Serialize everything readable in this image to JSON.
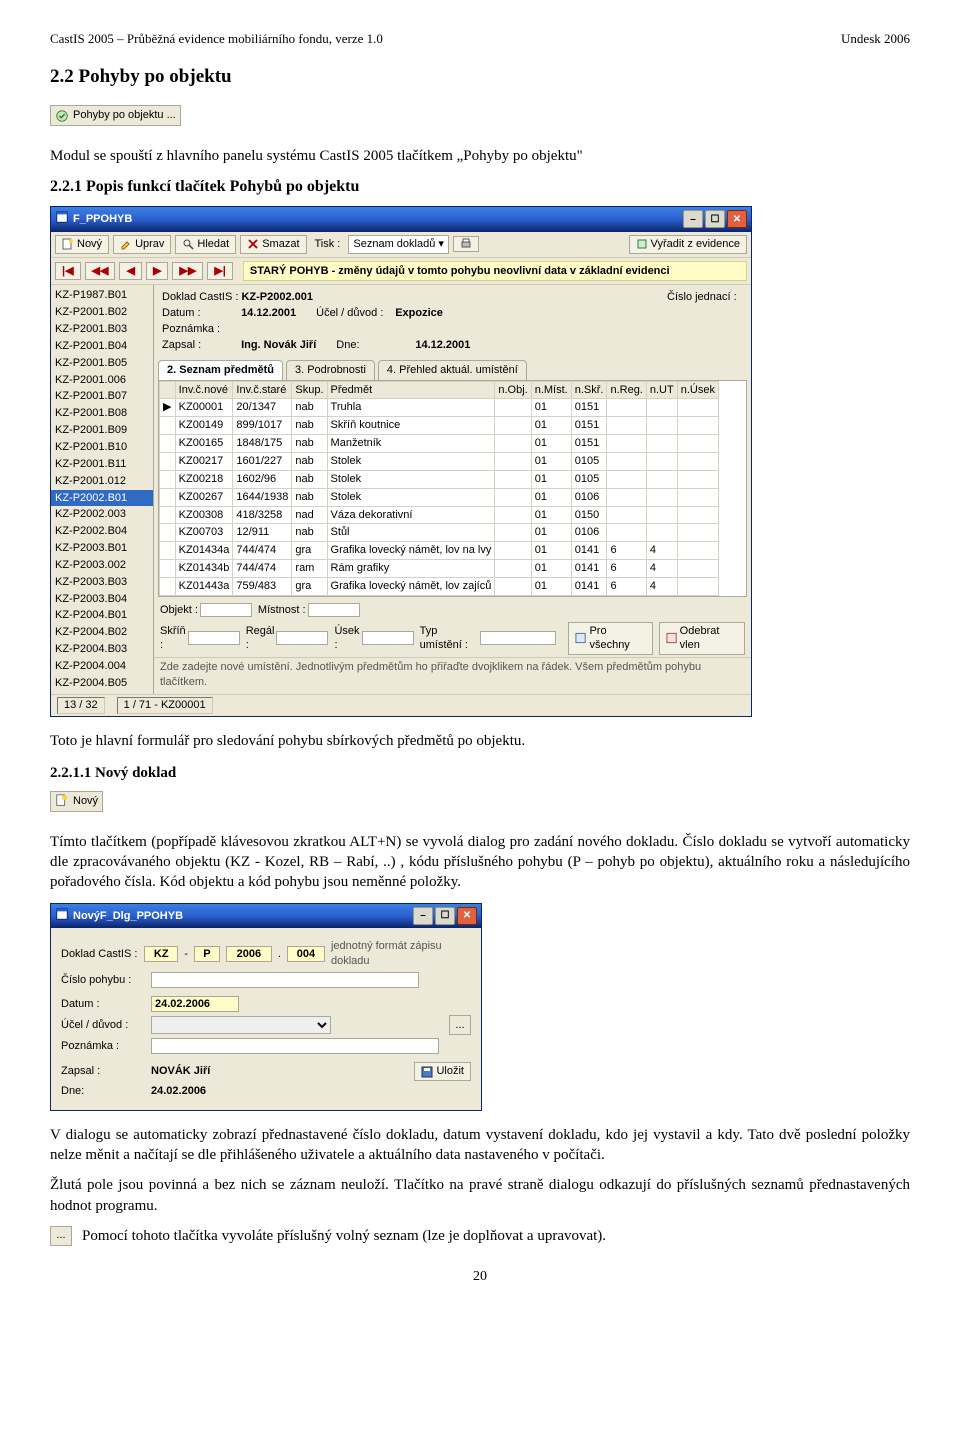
{
  "header": {
    "left": "CastIS 2005 – Průběžná evidence mobiliárního fondu, verze 1.0",
    "right": "Undesk 2006"
  },
  "section": {
    "number": "2.2",
    "title": "Pohyby po objektu"
  },
  "launcher_strip_label": "Pohyby po objektu ...",
  "body": {
    "p1": "Modul se spouští z hlavního panelu systému CastIS 2005 tlačítkem „Pohyby po objektu\"",
    "sub1_no": "2.2.1",
    "sub1_title": "Popis funkcí tlačítek Pohybů po objektu",
    "p2": "Toto je hlavní formulář pro sledování pohybu sbírkových předmětů po objektu.",
    "ss1_no": "2.2.1.1",
    "ss1_title": "Nový doklad",
    "new_btn": "Nový",
    "p3": "Tímto tlačítkem (popřípadě klávesovou zkratkou ALT+N) se vyvolá dialog pro zadání nového dokladu. Číslo dokladu se vytvoří automaticky dle zpracovávaného objektu (KZ - Kozel, RB – Rabí, ..) , kódu příslušného pohybu (P – pohyb po objektu), aktuálního roku a následujícího pořadového čísla. Kód objektu a kód pohybu jsou neměnné položky.",
    "p4": "V dialogu se automaticky zobrazí přednastavené číslo dokladu, datum vystavení dokladu, kdo jej vystavil a kdy. Tato dvě poslední položky nelze měnit a načítají se dle přihlášeného uživatele a aktuálního data nastaveného v počítači.",
    "p5": "Žlutá pole jsou povinná a bez nich se záznam neuloží. Tlačítko na pravé straně dialogu odkazují do příslušných seznamů přednastavených hodnot programu.",
    "p6": "Pomocí tohoto tlačítka vyvoláte příslušný volný seznam (lze je doplňovat a upravovat).",
    "page_number": "20"
  },
  "main_window": {
    "title": "F_PPOHYB",
    "toolbar": {
      "novy": "Nový",
      "uprav": "Uprav",
      "hledat": "Hledat",
      "smazat": "Smazat",
      "tisk_label": "Tisk :",
      "tisk_value": "Seznam dokladů",
      "vyradit": "Vyřadit z evidence"
    },
    "arrow_hint": "nav-arrows",
    "banner": "STARÝ POHYB - změny údajů v tomto pohybu neovlivní data v základní evidenci",
    "form": {
      "doklad_lab": "Doklad CastIS :",
      "doklad_val": "KZ-P2002.001",
      "cislojed_lab": "Číslo jednací :",
      "datum_lab": "Datum :",
      "datum_val": "14.12.2001",
      "ucel_lab": "Účel / důvod :",
      "ucel_val": "Expozice",
      "poznamka_lab": "Poznámka :",
      "zapsal_lab": "Zapsal :",
      "zapsal_val": "Ing. Novák Jiří",
      "dne_lab": "Dne:",
      "dne_val": "14.12.2001"
    },
    "tabs": [
      "2. Seznam předmětů",
      "3. Podrobnosti",
      "4. Přehled aktuál. umístění"
    ],
    "grid": {
      "columns": [
        "",
        "Inv.č.nové",
        "Inv.č.staré",
        "Skup.",
        "Předmět",
        "n.Obj.",
        "n.Míst.",
        "n.Skř.",
        "n.Reg.",
        "n.UT",
        "n.Úsek"
      ],
      "rows": [
        [
          "▶",
          "KZ00001",
          "20/1347",
          "nab",
          "Truhla",
          "",
          "01",
          "0151",
          "",
          "",
          ""
        ],
        [
          "",
          "KZ00149",
          "899/1017",
          "nab",
          "Skříň koutnice",
          "",
          "01",
          "0151",
          "",
          "",
          ""
        ],
        [
          "",
          "KZ00165",
          "1848/175",
          "nab",
          "Manžetník",
          "",
          "01",
          "0151",
          "",
          "",
          ""
        ],
        [
          "",
          "KZ00217",
          "1601/227",
          "nab",
          "Stolek",
          "",
          "01",
          "0105",
          "",
          "",
          ""
        ],
        [
          "",
          "KZ00218",
          "1602/96",
          "nab",
          "Stolek",
          "",
          "01",
          "0105",
          "",
          "",
          ""
        ],
        [
          "",
          "KZ00267",
          "1644/1938",
          "nab",
          "Stolek",
          "",
          "01",
          "0106",
          "",
          "",
          ""
        ],
        [
          "",
          "KZ00308",
          "418/3258",
          "nad",
          "Váza dekorativní",
          "",
          "01",
          "0150",
          "",
          "",
          ""
        ],
        [
          "",
          "KZ00703",
          "12/911",
          "nab",
          "Stůl",
          "",
          "01",
          "0106",
          "",
          "",
          ""
        ],
        [
          "",
          "KZ01434a",
          "744/474",
          "gra",
          "Grafika lovecký námět, lov na lvy",
          "",
          "01",
          "0141",
          "6",
          "4",
          ""
        ],
        [
          "",
          "KZ01434b",
          "744/474",
          "ram",
          "Rám grafiky",
          "",
          "01",
          "0141",
          "6",
          "4",
          ""
        ],
        [
          "",
          "KZ01443a",
          "759/483",
          "gra",
          "Grafika lovecký námět, lov zajíců",
          "",
          "01",
          "0141",
          "6",
          "4",
          ""
        ]
      ]
    },
    "filters": {
      "objekt": "Objekt :",
      "mistnost": "Místnost :",
      "skrin": "Skříň :",
      "regal": "Regál :",
      "usek": "Úsek :",
      "typ": "Typ umístění :",
      "pro_vsechny": "Pro všechny",
      "odebrat": "Odebrat vlen"
    },
    "hint": "Zde zadejte nové umístění. Jednotlivým předmětům ho přiřaďte dvojklikem na řádek. Všem předmětům pohybu tlačítkem.",
    "status": {
      "left": "13 / 32",
      "right": "1 / 71 - KZ00001"
    },
    "sidebar": [
      "KZ-P1987.B01",
      "KZ-P2001.B02",
      "KZ-P2001.B03",
      "KZ-P2001.B04",
      "KZ-P2001.B05",
      "KZ-P2001.006",
      "KZ-P2001.B07",
      "KZ-P2001.B08",
      "KZ-P2001.B09",
      "KZ-P2001.B10",
      "KZ-P2001.B11",
      "KZ-P2001.012",
      "KZ-P2002.B01",
      "KZ-P2002.003",
      "KZ-P2002.B04",
      "KZ-P2003.B01",
      "KZ-P2003.002",
      "KZ-P2003.B03",
      "KZ-P2003.B04",
      "KZ-P2004.B01",
      "KZ-P2004.B02",
      "KZ-P2004.B03",
      "KZ-P2004.004",
      "KZ-P2004.B05"
    ],
    "sidebar_selected_index": 12
  },
  "dialog": {
    "title": "NovýF_Dlg_PPOHYB",
    "doklad_lab": "Doklad CastIS :",
    "doklad_prefix": "KZ",
    "doklad_type": "P",
    "doklad_year": "2006",
    "doklad_seq": "004",
    "doklad_suffix": "jednotný formát zápisu dokladu",
    "cislo_lab": "Číslo pohybu :",
    "cislo_val": "",
    "datum_lab": "Datum :",
    "datum_val": "24.02.2006",
    "ucel_lab": "Účel / důvod :",
    "ucel_val": "",
    "poznamka_lab": "Poznámka :",
    "poznamka_val": "",
    "zapsal_lab": "Zapsal :",
    "zapsal_val": "NOVÁK Jiří",
    "dne_lab": "Dne:",
    "dne_val": "24.02.2006",
    "save_btn": "Uložit"
  }
}
